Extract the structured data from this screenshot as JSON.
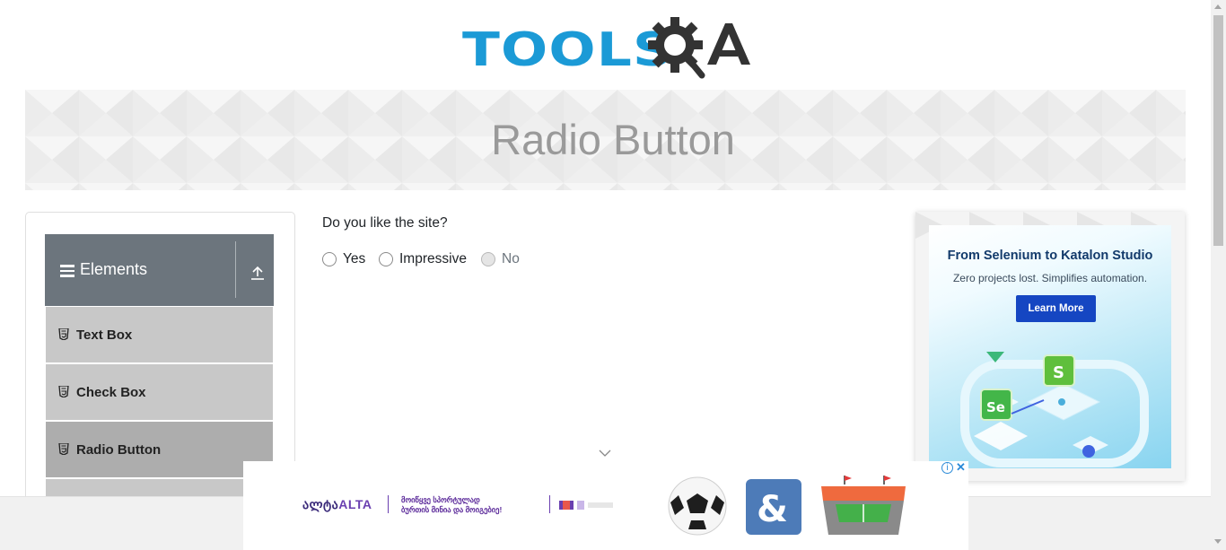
{
  "header": {
    "logo_text_left": "TOOLS",
    "logo_text_right": "QA",
    "logo_icon": "gear-magnifier-icon",
    "brand_color": "#1b9ad6"
  },
  "banner": {
    "title": "Radio Button"
  },
  "sidebar": {
    "group": {
      "title": "Elements",
      "menu_icon": "hamburger-icon",
      "collapse_icon": "upload-arrow-icon"
    },
    "items": [
      {
        "label": "Text Box",
        "icon": "html5-icon",
        "active": false
      },
      {
        "label": "Check Box",
        "icon": "html5-icon",
        "active": false
      },
      {
        "label": "Radio Button",
        "icon": "html5-icon",
        "active": true
      }
    ]
  },
  "main": {
    "question": "Do you like the site?",
    "options": [
      {
        "label": "Yes",
        "disabled": false
      },
      {
        "label": "Impressive",
        "disabled": false
      },
      {
        "label": "No",
        "disabled": true
      }
    ]
  },
  "ad_right": {
    "headline": "From Selenium to Katalon Studio",
    "subtitle": "Zero projects lost. Simplifies automation.",
    "button_label": "Learn More",
    "button_color": "#1546c2"
  },
  "ad_bottom": {
    "brand": "ალტა",
    "brand_alt": "ALTA",
    "slogan_line1": "მოიწყვე სპორტულად",
    "slogan_line2": "ბურთის მინია და მოიგებიე!",
    "info_icon": "info-icon",
    "close_icon": "close-icon"
  },
  "colors": {
    "sidebar_header": "#6c757d",
    "menu_item": "#c8c8c8",
    "menu_item_active": "#adadad"
  }
}
